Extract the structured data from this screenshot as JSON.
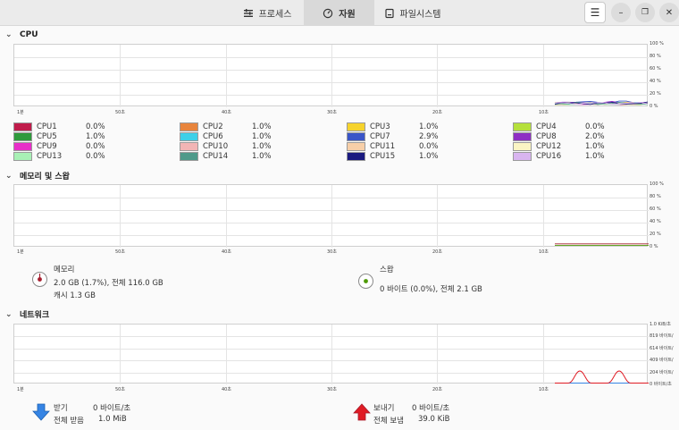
{
  "header": {
    "tabs": [
      {
        "label": "프로세스",
        "active": false
      },
      {
        "label": "자원",
        "active": true
      },
      {
        "label": "파일시스템",
        "active": false
      }
    ],
    "menu_icon": "hamburger-menu-icon",
    "window_buttons": [
      "minimize-icon",
      "restore-icon",
      "close-icon"
    ]
  },
  "cpu": {
    "title": "CPU",
    "y_labels": [
      "100 %",
      "80 %",
      "60 %",
      "40 %",
      "20 %",
      "0 %"
    ],
    "x_labels": [
      "1분",
      "50초",
      "40초",
      "30초",
      "20초",
      "10초"
    ],
    "cores": [
      {
        "name": "CPU1",
        "value": "0.0%",
        "color": "#c01c4b"
      },
      {
        "name": "CPU2",
        "value": "1.0%",
        "color": "#e8853d"
      },
      {
        "name": "CPU3",
        "value": "1.0%",
        "color": "#f6d32d"
      },
      {
        "name": "CPU4",
        "value": "0.0%",
        "color": "#b5e03c"
      },
      {
        "name": "CPU5",
        "value": "1.0%",
        "color": "#2e9a3c"
      },
      {
        "name": "CPU6",
        "value": "1.0%",
        "color": "#3dd0e8"
      },
      {
        "name": "CPU7",
        "value": "2.9%",
        "color": "#3a55c8"
      },
      {
        "name": "CPU8",
        "value": "2.0%",
        "color": "#8e2ec4"
      },
      {
        "name": "CPU9",
        "value": "0.0%",
        "color": "#e82ec8"
      },
      {
        "name": "CPU10",
        "value": "1.0%",
        "color": "#f2b5b5"
      },
      {
        "name": "CPU11",
        "value": "0.0%",
        "color": "#f7cfa8"
      },
      {
        "name": "CPU12",
        "value": "1.0%",
        "color": "#fbf5c4"
      },
      {
        "name": "CPU13",
        "value": "0.0%",
        "color": "#a8f0b5"
      },
      {
        "name": "CPU14",
        "value": "1.0%",
        "color": "#4e9a8a"
      },
      {
        "name": "CPU15",
        "value": "1.0%",
        "color": "#1a1a80"
      },
      {
        "name": "CPU16",
        "value": "1.0%",
        "color": "#d9b5f0"
      }
    ]
  },
  "memory": {
    "title": "메모리 및 스왑",
    "y_labels": [
      "100 %",
      "80 %",
      "60 %",
      "40 %",
      "20 %",
      "0 %"
    ],
    "x_labels": [
      "1분",
      "50초",
      "40초",
      "30초",
      "20초",
      "10초"
    ],
    "mem_label": "메모리",
    "mem_usage": "2.0 GB (1.7%), 전체 116.0 GB",
    "mem_cache": "캐시 1.3 GB",
    "mem_color": "#a51d2d",
    "swap_label": "스왑",
    "swap_usage": "0 바이트 (0.0%), 전체 2.1 GB",
    "swap_color": "#4e9a06"
  },
  "network": {
    "title": "네트워크",
    "y_labels": [
      "1.0 KiB/초",
      "819 바이트/",
      "614 바이트/",
      "409 바이트/",
      "204 바이트/",
      "0 바이트/초"
    ],
    "x_labels": [
      "1분",
      "50초",
      "40초",
      "30초",
      "20초",
      "10초"
    ],
    "recv_label": "받기",
    "recv_rate": "0 바이트/초",
    "recv_total_label": "전체 받음",
    "recv_total": "1.0 MiB",
    "recv_color": "#3584e4",
    "send_label": "보내기",
    "send_rate": "0 바이트/초",
    "send_total_label": "전체 보냄",
    "send_total": "39.0 KiB",
    "send_color": "#e01b24"
  }
}
